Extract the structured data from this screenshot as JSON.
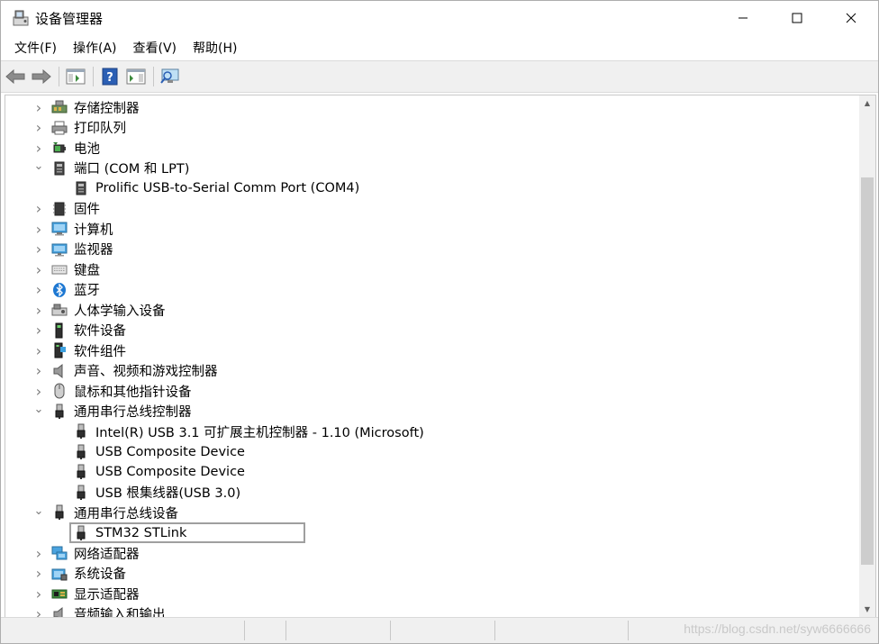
{
  "window": {
    "title": "设备管理器",
    "controls": {
      "minimize": "—",
      "maximize": "☐",
      "close": "✕"
    }
  },
  "menu": [
    "文件(F)",
    "操作(A)",
    "查看(V)",
    "帮助(H)"
  ],
  "toolbar": {
    "buttons": [
      "back-icon",
      "forward-icon",
      "properties-icon",
      "help-icon",
      "update-driver-icon",
      "scan-hardware-icon"
    ],
    "help_glyph": "?"
  },
  "tree": {
    "rows": [
      {
        "level": 0,
        "expanded": false,
        "icon": "storage-controller-icon",
        "label": "存储控制器"
      },
      {
        "level": 0,
        "expanded": false,
        "icon": "print-queue-icon",
        "label": "打印队列"
      },
      {
        "level": 0,
        "expanded": false,
        "icon": "battery-icon",
        "label": "电池"
      },
      {
        "level": 0,
        "expanded": true,
        "icon": "port-icon",
        "label": "端口 (COM 和 LPT)"
      },
      {
        "level": 1,
        "icon": "port-icon",
        "label": "Prolific USB-to-Serial Comm Port (COM4)"
      },
      {
        "level": 0,
        "expanded": false,
        "icon": "firmware-icon",
        "label": "固件"
      },
      {
        "level": 0,
        "expanded": false,
        "icon": "computer-icon",
        "label": "计算机"
      },
      {
        "level": 0,
        "expanded": false,
        "icon": "monitor-icon",
        "label": "监视器"
      },
      {
        "level": 0,
        "expanded": false,
        "icon": "keyboard-icon",
        "label": "键盘"
      },
      {
        "level": 0,
        "expanded": false,
        "icon": "bluetooth-icon",
        "label": "蓝牙"
      },
      {
        "level": 0,
        "expanded": false,
        "icon": "hid-icon",
        "label": "人体学输入设备"
      },
      {
        "level": 0,
        "expanded": false,
        "icon": "software-device-icon",
        "label": "软件设备"
      },
      {
        "level": 0,
        "expanded": false,
        "icon": "software-component-icon",
        "label": "软件组件"
      },
      {
        "level": 0,
        "expanded": false,
        "icon": "speaker-icon",
        "label": "声音、视频和游戏控制器"
      },
      {
        "level": 0,
        "expanded": false,
        "icon": "mouse-icon",
        "label": "鼠标和其他指针设备"
      },
      {
        "level": 0,
        "expanded": true,
        "icon": "usb-plug-icon",
        "label": "通用串行总线控制器"
      },
      {
        "level": 1,
        "icon": "usb-plug-icon",
        "label": "Intel(R) USB 3.1 可扩展主机控制器 - 1.10 (Microsoft)"
      },
      {
        "level": 1,
        "icon": "usb-plug-icon",
        "label": "USB Composite Device"
      },
      {
        "level": 1,
        "icon": "usb-plug-icon",
        "label": "USB Composite Device"
      },
      {
        "level": 1,
        "icon": "usb-plug-icon",
        "label": "USB 根集线器(USB 3.0)"
      },
      {
        "level": 0,
        "expanded": true,
        "icon": "usb-plug-icon",
        "label": "通用串行总线设备"
      },
      {
        "level": 1,
        "icon": "usb-plug-icon",
        "label": "STM32 STLink",
        "selected": true
      },
      {
        "level": 0,
        "expanded": false,
        "icon": "network-adapter-icon",
        "label": "网络适配器"
      },
      {
        "level": 0,
        "expanded": false,
        "icon": "system-device-icon",
        "label": "系统设备"
      },
      {
        "level": 0,
        "expanded": false,
        "icon": "display-adapter-icon",
        "label": "显示适配器"
      },
      {
        "level": 0,
        "expanded": false,
        "icon": "audio-io-icon",
        "label": "音频输入和输出"
      }
    ],
    "chevron_collapsed": "›",
    "chevron_expanded": "⌄"
  },
  "scrollbar": {
    "up": "▲",
    "down": "▼"
  },
  "watermark": "https://blog.csdn.net/syw6666666",
  "colors": {
    "window_bg": "#ffffff",
    "chrome_bg": "#f0f0f0",
    "selection_border": "#9f9f9f"
  }
}
